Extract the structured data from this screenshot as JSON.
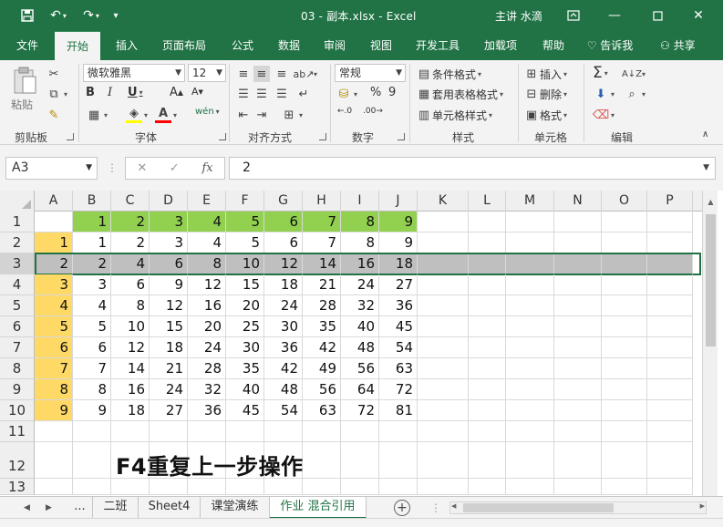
{
  "window": {
    "title": "03 - 副本.xlsx - Excel",
    "user": "主讲 水滴",
    "accent": "#217346"
  },
  "qat": {
    "save_icon": "save-icon",
    "undo_icon": "undo-icon",
    "redo_icon": "redo-icon"
  },
  "tabs": [
    "文件",
    "开始",
    "插入",
    "页面布局",
    "公式",
    "数据",
    "审阅",
    "视图",
    "开发工具",
    "加载项",
    "帮助"
  ],
  "active_tab": "开始",
  "tell_me": "告诉我",
  "share": "共享",
  "ribbon": {
    "clipboard": {
      "label": "剪贴板",
      "paste": "粘贴"
    },
    "font": {
      "label": "字体",
      "name": "微软雅黑",
      "size": "12",
      "bold": "B",
      "italic": "I",
      "underline": "U",
      "grow": "A",
      "shrink": "A",
      "font_color_letter": "A",
      "wen": "wén"
    },
    "alignment": {
      "label": "对齐方式"
    },
    "number": {
      "label": "数字",
      "format": "常规",
      "percent": "%",
      "comma": "9"
    },
    "styles": {
      "label": "样式",
      "conditional": "条件格式",
      "table": "套用表格格式",
      "cell": "单元格样式"
    },
    "cells": {
      "label": "单元格",
      "insert": "插入",
      "delete": "删除",
      "format": "格式"
    },
    "editing": {
      "label": "编辑",
      "sum": "Σ"
    }
  },
  "formula_bar": {
    "name_box": "A3",
    "cancel": "✕",
    "enter": "✓",
    "fx": "fx",
    "content": "2"
  },
  "grid": {
    "columns": [
      "A",
      "B",
      "C",
      "D",
      "E",
      "F",
      "G",
      "H",
      "I",
      "J",
      "K",
      "L",
      "M",
      "N",
      "O",
      "P"
    ],
    "row_numbers": [
      "1",
      "2",
      "3",
      "4",
      "5",
      "6",
      "7",
      "8",
      "9",
      "10",
      "11",
      "12",
      "13"
    ],
    "selected_row": "3",
    "cells": [
      [
        "",
        "1",
        "2",
        "3",
        "4",
        "5",
        "6",
        "7",
        "8",
        "9"
      ],
      [
        "1",
        "1",
        "2",
        "3",
        "4",
        "5",
        "6",
        "7",
        "8",
        "9"
      ],
      [
        "2",
        "2",
        "4",
        "6",
        "8",
        "10",
        "12",
        "14",
        "16",
        "18"
      ],
      [
        "3",
        "3",
        "6",
        "9",
        "12",
        "15",
        "18",
        "21",
        "24",
        "27"
      ],
      [
        "4",
        "4",
        "8",
        "12",
        "16",
        "20",
        "24",
        "28",
        "32",
        "36"
      ],
      [
        "5",
        "5",
        "10",
        "15",
        "20",
        "25",
        "30",
        "35",
        "40",
        "45"
      ],
      [
        "6",
        "6",
        "12",
        "18",
        "24",
        "30",
        "36",
        "42",
        "48",
        "54"
      ],
      [
        "7",
        "7",
        "14",
        "21",
        "28",
        "35",
        "42",
        "49",
        "56",
        "63"
      ],
      [
        "8",
        "8",
        "16",
        "24",
        "32",
        "40",
        "48",
        "56",
        "64",
        "72"
      ],
      [
        "9",
        "9",
        "18",
        "27",
        "36",
        "45",
        "54",
        "63",
        "72",
        "81"
      ]
    ],
    "note": "F4重复上一步操作",
    "colors": {
      "header_fill": "#92d050",
      "index_fill": "#ffd966",
      "selected_row_fill": "#bfbfbf"
    }
  },
  "sheets": {
    "ellipsis": "...",
    "tabs": [
      "二班",
      "Sheet4",
      "课堂演练",
      "作业 混合引用"
    ],
    "active": "作业 混合引用"
  }
}
